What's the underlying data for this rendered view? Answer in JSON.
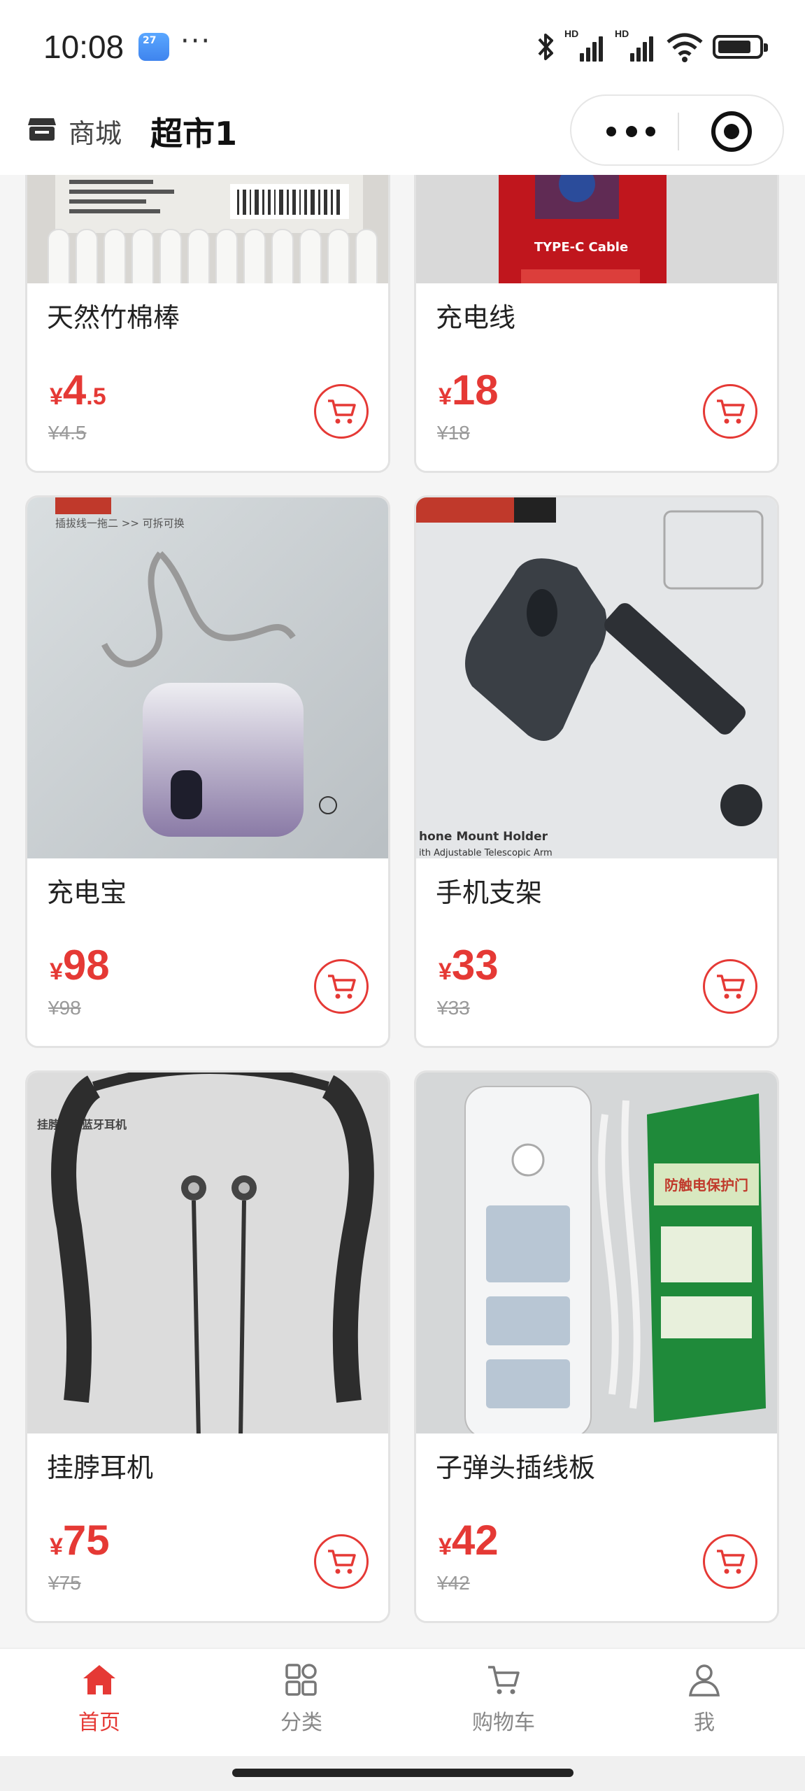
{
  "status_bar": {
    "time": "10:08",
    "weather_badge": "27",
    "more": "···",
    "battery_level": 0.8
  },
  "nav": {
    "store_label": "商城",
    "title": "超市1"
  },
  "accent_color": "#e53935",
  "products": [
    {
      "name": "天然竹棉棒",
      "price_int": "4",
      "price_dec": ".5",
      "currency": "¥",
      "original_price": "¥4.5",
      "image": "cotton-swabs-photo"
    },
    {
      "name": "充电线",
      "price_int": "18",
      "price_dec": "",
      "currency": "¥",
      "original_price": "¥18",
      "image": "charging-cable-photo",
      "image_text": "TYPE-C Cable"
    },
    {
      "name": "充电宝",
      "price_int": "98",
      "price_dec": "",
      "currency": "¥",
      "original_price": "¥98",
      "image": "power-bank-photo",
      "image_text": "插拔线一拖二 >> 可拆可换"
    },
    {
      "name": "手机支架",
      "price_int": "33",
      "price_dec": "",
      "currency": "¥",
      "original_price": "¥33",
      "image": "phone-mount-photo",
      "image_text": "hone Mount Holder",
      "image_text2": "ith Adjustable Telescopic Arm"
    },
    {
      "name": "挂脖耳机",
      "price_int": "75",
      "price_dec": "",
      "currency": "¥",
      "original_price": "¥75",
      "image": "neckband-earphones-photo",
      "image_text": "挂脖运动蓝牙耳机"
    },
    {
      "name": "子弹头插线板",
      "price_int": "42",
      "price_dec": "",
      "currency": "¥",
      "original_price": "¥42",
      "image": "power-strip-photo",
      "image_text": "防触电保护门"
    }
  ],
  "tabs": [
    {
      "label": "首页",
      "icon": "home-icon",
      "active": true
    },
    {
      "label": "分类",
      "icon": "category-icon",
      "active": false
    },
    {
      "label": "购物车",
      "icon": "cart-icon",
      "active": false
    },
    {
      "label": "我",
      "icon": "user-icon",
      "active": false
    }
  ]
}
